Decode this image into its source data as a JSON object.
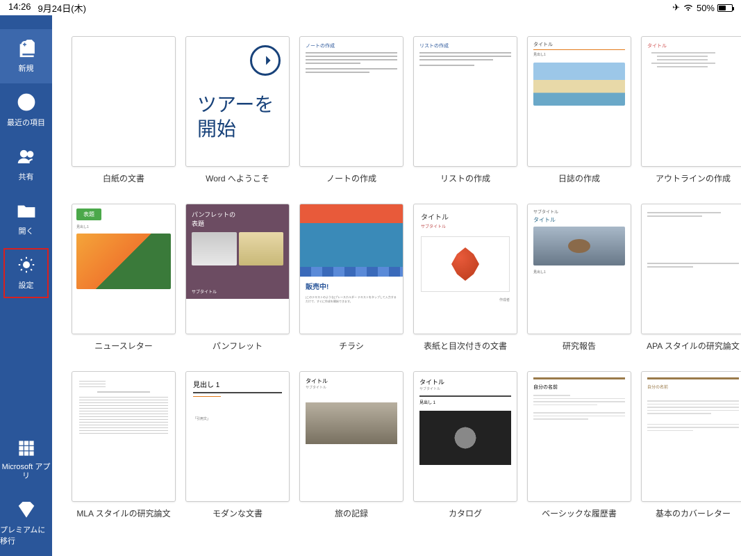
{
  "status": {
    "time": "14:26",
    "date": "9月24日(木)",
    "battery_pct": "50%"
  },
  "sidebar": {
    "items": [
      {
        "label": "新規"
      },
      {
        "label": "最近の項目"
      },
      {
        "label": "共有"
      },
      {
        "label": "開く"
      },
      {
        "label": "設定"
      }
    ],
    "bottom": [
      {
        "label": "Microsoft アプリ"
      },
      {
        "label": "プレミアムに移行"
      }
    ]
  },
  "tour": {
    "line1": "ツアーを",
    "line2": "開始"
  },
  "thumbtext": {
    "note_title": "ノートの作成",
    "list_title": "リストの作成",
    "diary_title": "タイトル",
    "diary_sub": "見出し1",
    "outline_title": "タイトル",
    "news_chip": "表題",
    "brochure_t1": "パンフレットの",
    "brochure_t2": "表題",
    "brochure_sub": "サブタイトル",
    "flyer_cap": "販売中!",
    "flyer_sm": "[このテキストのような]プレースホルダー テキストをタップして入力するだけで、すぐに作成を開始できます。",
    "cover_t": "タイトル",
    "cover_s": "サブタイトル",
    "cover_au": "作成者",
    "research_tt": "サブタイトル",
    "research_mt": "タイトル",
    "research_h": "見出し1",
    "modern_h": "見出し 1",
    "modern_q": "「引用文」",
    "trip_t": "タイトル",
    "trip_s": "サブタイトル",
    "catalog_t": "タイトル",
    "catalog_s": "サブタイトル",
    "catalog_h": "見出し 1",
    "resume_t": "自分の名前"
  },
  "templates": [
    {
      "label": "白紙の文書"
    },
    {
      "label": "Word へようこそ"
    },
    {
      "label": "ノートの作成"
    },
    {
      "label": "リストの作成"
    },
    {
      "label": "日誌の作成"
    },
    {
      "label": "アウトラインの作成"
    },
    {
      "label": "ニュースレター"
    },
    {
      "label": "パンフレット"
    },
    {
      "label": "チラシ"
    },
    {
      "label": "表紙と目次付きの文書"
    },
    {
      "label": "研究報告"
    },
    {
      "label": "APA スタイルの研究論文"
    },
    {
      "label": "MLA スタイルの研究論文"
    },
    {
      "label": "モダンな文書"
    },
    {
      "label": "旅の記録"
    },
    {
      "label": "カタログ"
    },
    {
      "label": "ベーシックな履歴書"
    },
    {
      "label": "基本のカバーレター"
    }
  ]
}
